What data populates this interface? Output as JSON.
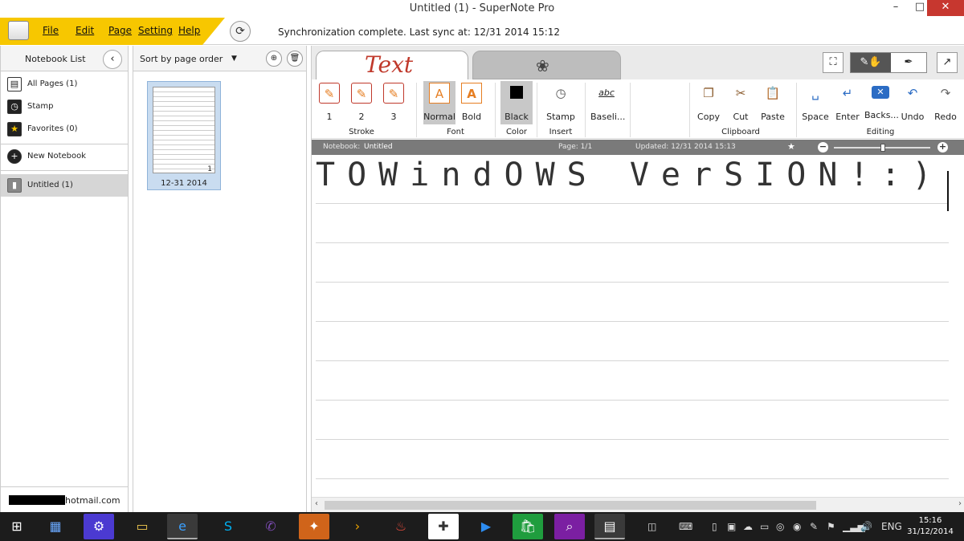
{
  "window": {
    "title": "Untitled (1) - SuperNote Pro",
    "min": "–",
    "max": "□",
    "close": "✕"
  },
  "menu": {
    "items": [
      "File",
      "Edit",
      "Page",
      "Setting",
      "Help"
    ],
    "sync_status": "Synchronization complete. Last sync at:  12/31 2014 15:12"
  },
  "notebook_panel": {
    "header": "Notebook List",
    "items": [
      {
        "label": "All Pages (1)",
        "icon": "pages-icon"
      },
      {
        "label": "Stamp",
        "icon": "clock-icon"
      },
      {
        "label": "Favorites (0)",
        "icon": "star-icon"
      }
    ],
    "new_notebook": "New Notebook",
    "notebooks": [
      {
        "label": "Untitled (1)",
        "selected": true
      }
    ],
    "account": "hotmail.com"
  },
  "page_panel": {
    "sort_label": "Sort by page order",
    "thumb_page_number": "1",
    "thumb_date": "12-31 2014"
  },
  "editor": {
    "tab_text": "Text",
    "tab_draw_icon": "flower-icon",
    "ribbon": {
      "stroke": {
        "buttons": [
          "1",
          "2",
          "3"
        ],
        "label": "Stroke"
      },
      "font": {
        "buttons": [
          "Normal",
          "Bold"
        ],
        "label": "Font",
        "selected": "Normal"
      },
      "color": {
        "button": "Black",
        "label": "Color",
        "value": "#000000"
      },
      "insert": {
        "button": "Stamp",
        "label": "Insert"
      },
      "baseline": {
        "button": "Baseli...",
        "sample": "abc"
      },
      "clipboard": {
        "buttons": [
          "Copy",
          "Cut",
          "Paste"
        ],
        "label": "Clipboard"
      },
      "editing": {
        "buttons": [
          "Space",
          "Enter",
          "Backs...",
          "Undo",
          "Redo"
        ],
        "label": "Editing"
      }
    },
    "infobar": {
      "notebook_label": "Notebook:",
      "notebook_name": "Untitled",
      "page": "Page: 1/1",
      "updated": "Updated: 12/31 2014 15:13"
    },
    "handwriting": "TOWindOWS VerSION!:)"
  },
  "taskbar": {
    "lang": "ENG",
    "time": "15:16",
    "date": "31/12/2014"
  },
  "colors": {
    "accent_yellow": "#f7c700",
    "tab_text_red": "#c0392b",
    "close_red": "#c7372f"
  }
}
